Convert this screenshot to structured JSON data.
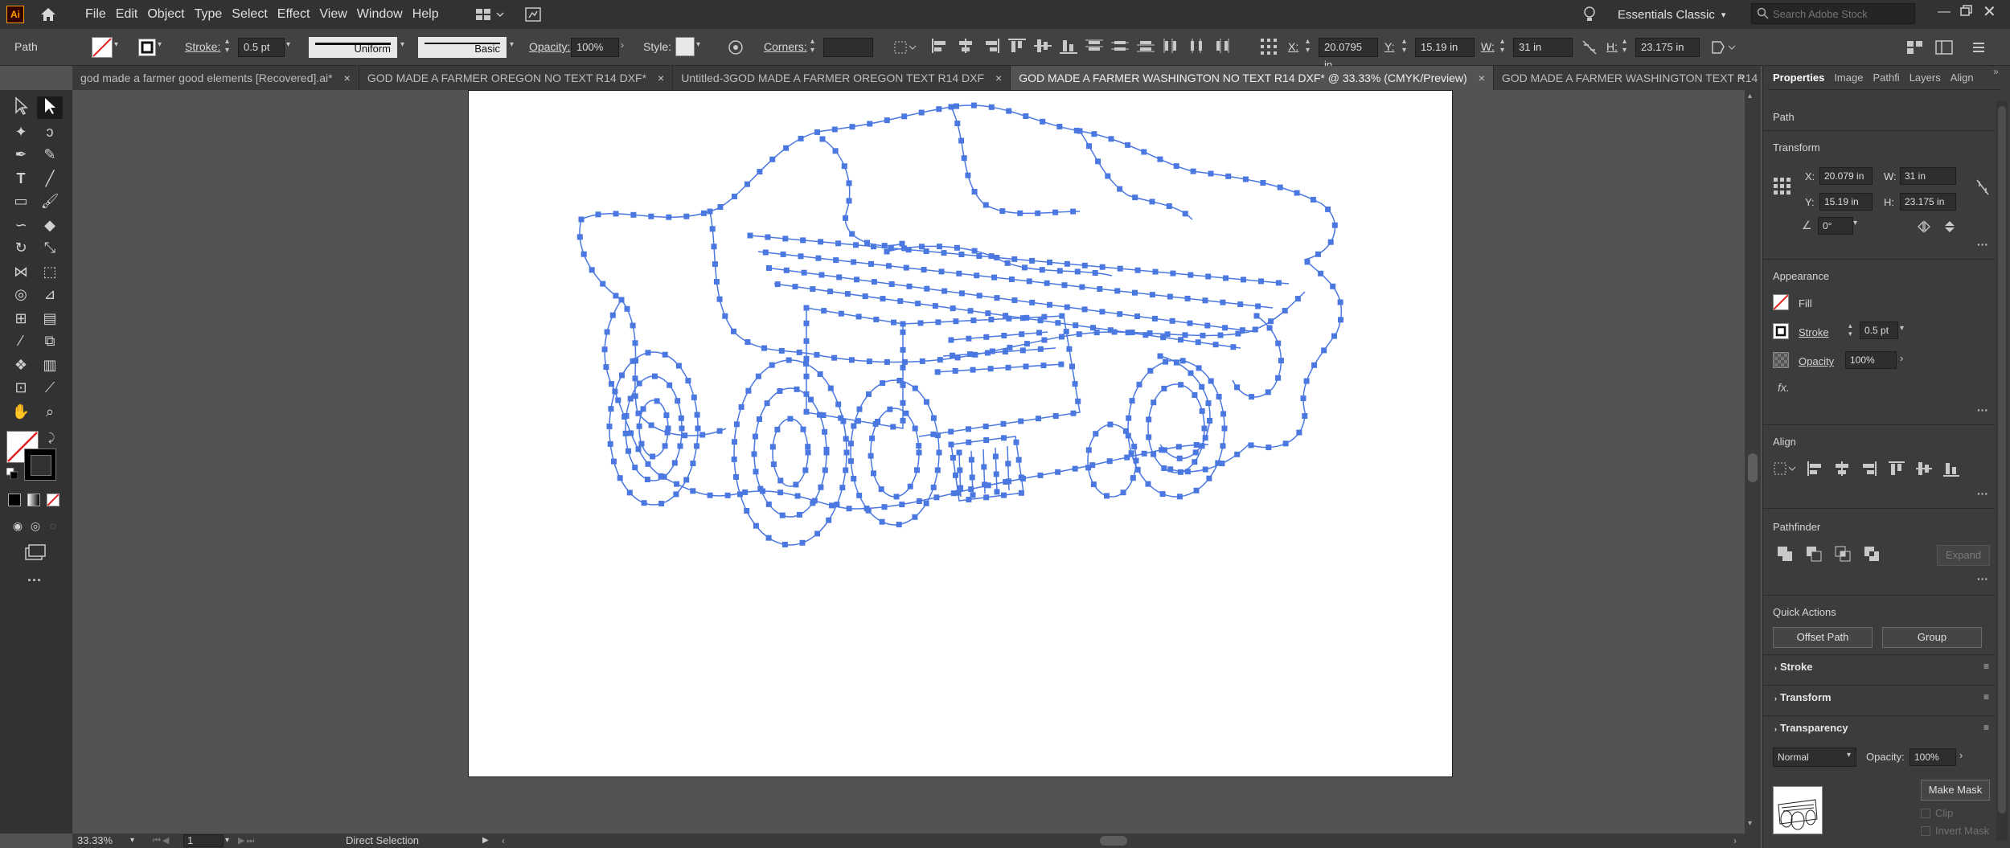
{
  "app": {
    "logo": "Ai",
    "workspace": "Essentials Classic",
    "search_placeholder": "Search Adobe Stock"
  },
  "menu": [
    "File",
    "Edit",
    "Object",
    "Type",
    "Select",
    "Effect",
    "View",
    "Window",
    "Help"
  ],
  "control": {
    "selection_type": "Path",
    "stroke_label": "Stroke:",
    "stroke_value": "0.5 pt",
    "profile": "Uniform",
    "brush": "Basic",
    "opacity_label": "Opacity:",
    "opacity_value": "100%",
    "style_label": "Style:",
    "corners_label": "Corners:",
    "x_label": "X:",
    "x_value": "20.0795 in",
    "y_label": "Y:",
    "y_value": "15.19 in",
    "w_label": "W:",
    "w_value": "31 in",
    "h_label": "H:",
    "h_value": "23.175 in"
  },
  "tabs": [
    {
      "label": "god made a farmer good elements [Recovered].ai*",
      "close": "×",
      "active": false
    },
    {
      "label": "GOD MADE A FARMER OREGON NO TEXT R14 DXF*",
      "close": "×",
      "active": false
    },
    {
      "label": "Untitled-3GOD MADE A FARMER OREGON TEXT R14 DXF",
      "close": "×",
      "active": false
    },
    {
      "label": "GOD MADE A FARMER WASHINGTON NO TEXT R14 DXF* @ 33.33% (CMYK/Preview)",
      "close": "×",
      "active": true
    },
    {
      "label": "GOD MADE A FARMER WASHINGTON TEXT R14",
      "close": "",
      "active": false
    }
  ],
  "panel": {
    "tabs": [
      "Properties",
      "Image",
      "Pathfi",
      "Layers",
      "Align"
    ],
    "selection": "Path",
    "transform_title": "Transform",
    "x_label": "X:",
    "x_value": "20.079 in",
    "y_label": "Y:",
    "y_value": "15.19 in",
    "w_label": "W:",
    "w_value": "31 in",
    "h_label": "H:",
    "h_value": "23.175 in",
    "angle_value": "0°",
    "appearance_title": "Appearance",
    "fill_label": "Fill",
    "stroke_label": "Stroke",
    "stroke_value": "0.5 pt",
    "opacity_label": "Opacity",
    "opacity_value": "100%",
    "fx_label": "fx.",
    "align_title": "Align",
    "pathfinder_title": "Pathfinder",
    "expand_label": "Expand",
    "quick_actions_title": "Quick Actions",
    "offset_path_label": "Offset Path",
    "group_label": "Group",
    "collapsed": [
      "Stroke",
      "Transform",
      "Transparency"
    ],
    "blend_mode": "Normal",
    "t_opacity_label": "Opacity:",
    "t_opacity_value": "100%",
    "make_mask_label": "Make Mask",
    "clip_label": "Clip",
    "invert_mask_label": "Invert Mask"
  },
  "status": {
    "zoom": "33.33%",
    "artboard": "1",
    "tool": "Direct Selection"
  },
  "colors": {
    "path_blue": "#4a78e0",
    "active_tab": "#535353",
    "chrome": "#323232"
  }
}
